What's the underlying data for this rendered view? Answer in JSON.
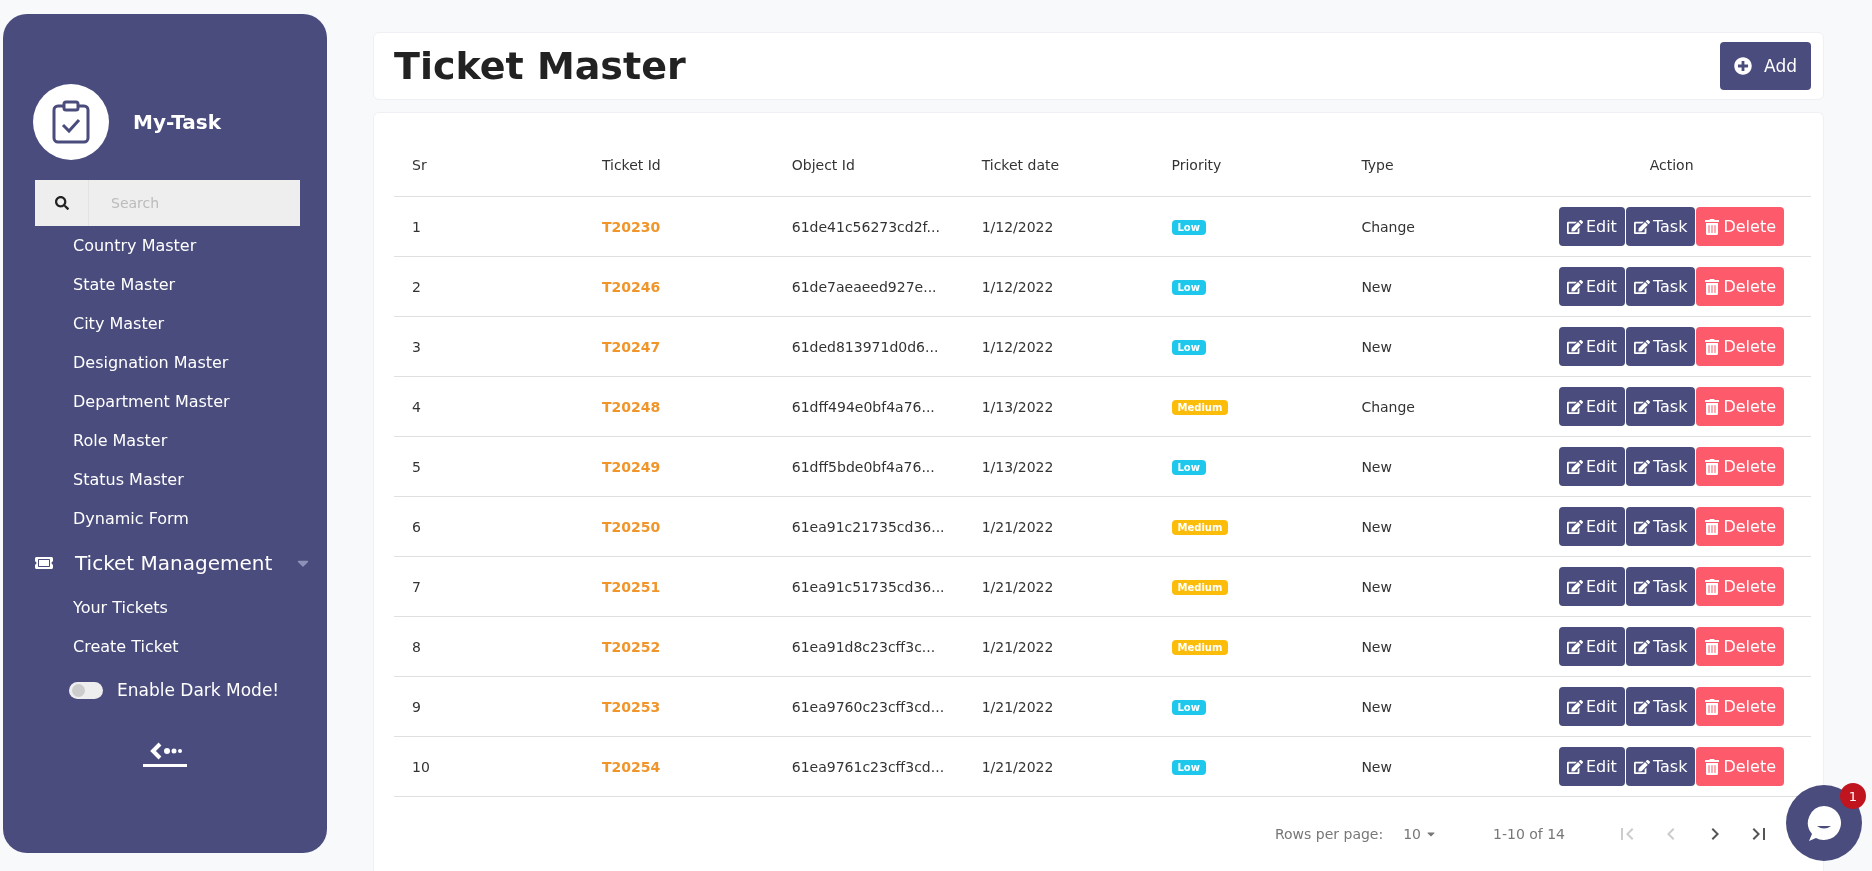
{
  "sidebar": {
    "app_name": "My-Task",
    "search": {
      "placeholder": "Search"
    },
    "items": [
      {
        "label": "Country Master"
      },
      {
        "label": "State Master"
      },
      {
        "label": "City Master"
      },
      {
        "label": "Designation Master"
      },
      {
        "label": "Department Master"
      },
      {
        "label": "Role Master"
      },
      {
        "label": "Status Master"
      },
      {
        "label": "Dynamic Form"
      }
    ],
    "group": {
      "label": "Ticket Management",
      "expanded": true,
      "children": [
        {
          "label": "Your Tickets"
        },
        {
          "label": "Create Ticket"
        }
      ]
    },
    "dark_mode": {
      "label": "Enable Dark Mode!",
      "on": false
    }
  },
  "header": {
    "title": "Ticket Master",
    "add_button": "Add"
  },
  "table": {
    "columns": [
      "Sr",
      "Ticket Id",
      "Object Id",
      "Ticket date",
      "Priority",
      "Type",
      "Action"
    ],
    "rows": [
      {
        "sr": "1",
        "ticket_id": "T20230",
        "object_id": "61de41c56273cd2f...",
        "date": "1/12/2022",
        "priority": {
          "label": "Low",
          "kind": "low"
        },
        "type": "Change",
        "actions": [
          "Edit",
          "Task",
          "Delete"
        ]
      },
      {
        "sr": "2",
        "ticket_id": "T20246",
        "object_id": "61de7aeaeed927e...",
        "date": "1/12/2022",
        "priority": {
          "label": "Low",
          "kind": "low"
        },
        "type": "New",
        "actions": [
          "Edit",
          "Task",
          "Delete"
        ]
      },
      {
        "sr": "3",
        "ticket_id": "T20247",
        "object_id": "61ded813971d0d6...",
        "date": "1/12/2022",
        "priority": {
          "label": "Low",
          "kind": "low"
        },
        "type": "New",
        "actions": [
          "Edit",
          "Task",
          "Delete"
        ]
      },
      {
        "sr": "4",
        "ticket_id": "T20248",
        "object_id": "61dff494e0bf4a76...",
        "date": "1/13/2022",
        "priority": {
          "label": "Medium",
          "kind": "medium"
        },
        "type": "Change",
        "actions": [
          "Edit",
          "Task",
          "Delete"
        ]
      },
      {
        "sr": "5",
        "ticket_id": "T20249",
        "object_id": "61dff5bde0bf4a76...",
        "date": "1/13/2022",
        "priority": {
          "label": "Low",
          "kind": "low"
        },
        "type": "New",
        "actions": [
          "Edit",
          "Task",
          "Delete"
        ]
      },
      {
        "sr": "6",
        "ticket_id": "T20250",
        "object_id": "61ea91c21735cd36...",
        "date": "1/21/2022",
        "priority": {
          "label": "Medium",
          "kind": "medium"
        },
        "type": "New",
        "actions": [
          "Edit",
          "Task",
          "Delete"
        ]
      },
      {
        "sr": "7",
        "ticket_id": "T20251",
        "object_id": "61ea91c51735cd36...",
        "date": "1/21/2022",
        "priority": {
          "label": "Medium",
          "kind": "medium"
        },
        "type": "New",
        "actions": [
          "Edit",
          "Task",
          "Delete"
        ]
      },
      {
        "sr": "8",
        "ticket_id": "T20252",
        "object_id": "61ea91d8c23cff3c...",
        "date": "1/21/2022",
        "priority": {
          "label": "Medium",
          "kind": "medium"
        },
        "type": "New",
        "actions": [
          "Edit",
          "Task",
          "Delete"
        ]
      },
      {
        "sr": "9",
        "ticket_id": "T20253",
        "object_id": "61ea9760c23cff3cd...",
        "date": "1/21/2022",
        "priority": {
          "label": "Low",
          "kind": "low"
        },
        "type": "New",
        "actions": [
          "Edit",
          "Task",
          "Delete"
        ]
      },
      {
        "sr": "10",
        "ticket_id": "T20254",
        "object_id": "61ea9761c23cff3cd...",
        "date": "1/21/2022",
        "priority": {
          "label": "Low",
          "kind": "low"
        },
        "type": "New",
        "actions": [
          "Edit",
          "Task",
          "Delete"
        ]
      }
    ]
  },
  "pagination": {
    "rows_per_page_label": "Rows per page:",
    "rows_per_page": "10",
    "range": "1-10 of 14",
    "first_disabled": true,
    "prev_disabled": true,
    "next_disabled": false,
    "last_disabled": false
  },
  "chat": {
    "badge": "1"
  }
}
